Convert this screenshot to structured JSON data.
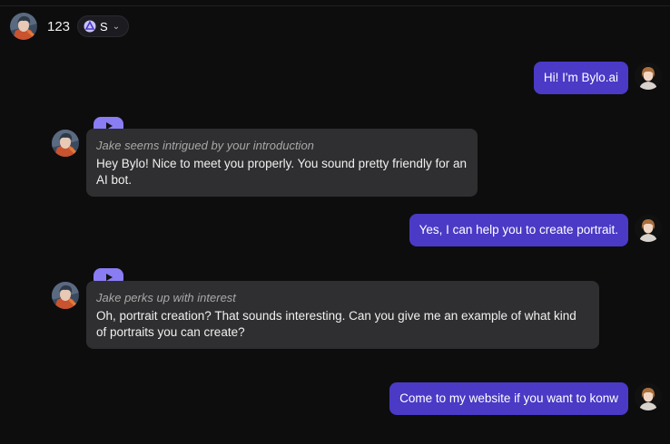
{
  "header": {
    "name": "123",
    "model_label": "S",
    "dropdown_icon": "chevron-down-icon"
  },
  "messages": [
    {
      "role": "user",
      "text": "Hi! I'm Bylo.ai"
    },
    {
      "role": "bot",
      "action": "Jake seems intrigued by your introduction",
      "text": "Hey Bylo! Nice to meet you properly. You sound pretty friendly for an AI bot."
    },
    {
      "role": "user",
      "text": "Yes, I can help you to create portrait."
    },
    {
      "role": "bot",
      "action": "Jake perks up with interest",
      "text": "Oh, portrait creation? That sounds interesting. Can you give me an example of what kind of portraits you can create?"
    },
    {
      "role": "user",
      "text": "Come to my website if you want to konw"
    }
  ],
  "colors": {
    "background": "#0d0d0e",
    "user_bubble": "#4a3ac6",
    "bot_bubble": "#2f2f31",
    "play_tab": "#8a7cf2"
  }
}
